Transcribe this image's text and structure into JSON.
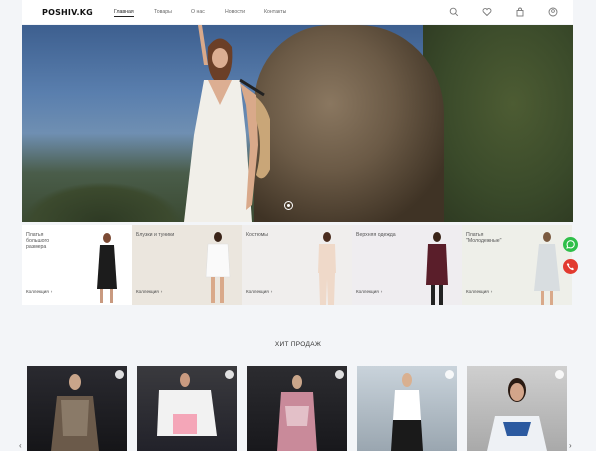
{
  "header": {
    "logo": "POSHIV.KG",
    "nav": [
      "Главная",
      "Товары",
      "О нас",
      "Новости",
      "Контакты"
    ],
    "icons": [
      "search-icon",
      "heart-icon",
      "bag-icon",
      "user-icon"
    ]
  },
  "hero": {
    "slider_indicator": "slide-dot"
  },
  "categories": [
    {
      "title": "Платья большого размера",
      "cta": "Коллекция",
      "arrow": "›"
    },
    {
      "title": "Блузки и туники",
      "cta": "Коллекция",
      "arrow": "›"
    },
    {
      "title": "Костюмы",
      "cta": "Коллекция",
      "arrow": "›"
    },
    {
      "title": "Верхняя одежда",
      "cta": "Коллекция",
      "arrow": "›"
    },
    {
      "title": "Платья \"Молодежные\"",
      "cta": "Коллекция",
      "arrow": "›"
    }
  ],
  "floating": {
    "whatsapp": "whatsapp-icon",
    "phone": "phone-icon"
  },
  "bestsellers": {
    "title": "ХИТ ПРОДАЖ",
    "prev": "‹",
    "next": "›"
  },
  "colors": {
    "accent": "#222222",
    "whatsapp": "#2fbf4a",
    "phone": "#e23a2f"
  }
}
